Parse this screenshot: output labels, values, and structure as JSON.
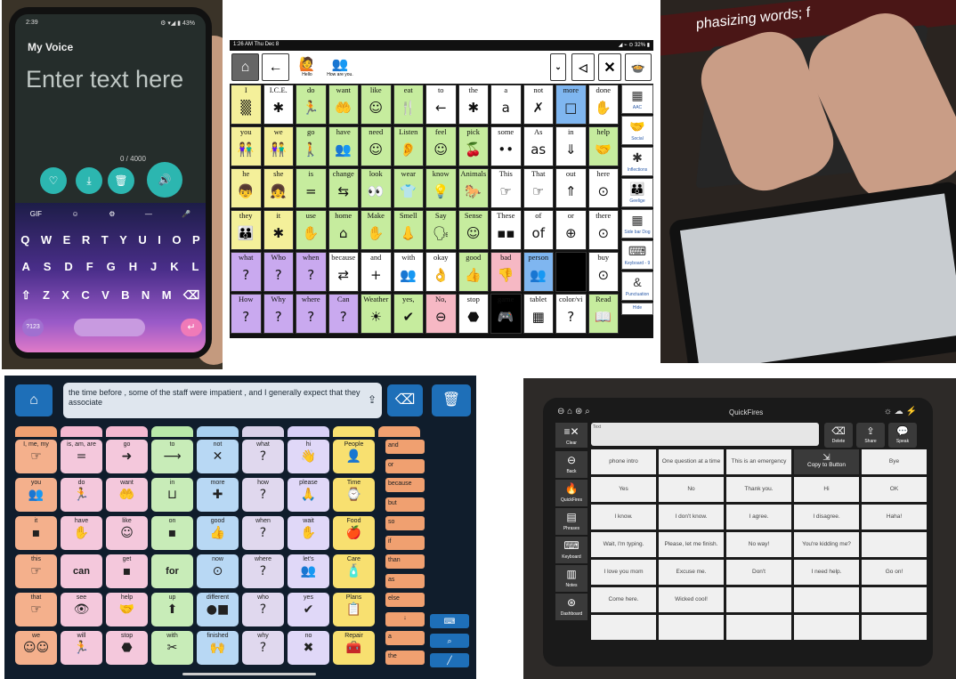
{
  "phone": {
    "time": "2:39",
    "status": "⚙ ▾◢ ▮ 43%",
    "app_title": "My Voice",
    "placeholder": "Enter text here",
    "counter": "0 / 4000",
    "rows": [
      [
        "Q",
        "W",
        "E",
        "R",
        "T",
        "Y",
        "U",
        "I",
        "O",
        "P"
      ],
      [
        "A",
        "S",
        "D",
        "F",
        "G",
        "H",
        "J",
        "K",
        "L"
      ],
      [
        "⇧",
        "Z",
        "X",
        "C",
        "V",
        "B",
        "N",
        "M",
        "⌫"
      ]
    ],
    "icons": [
      "heart-icon",
      "download-icon",
      "trash-icon",
      "speaker-icon"
    ],
    "num_key": "?123",
    "suggest": [
      "GIF",
      "☺",
      "⚙",
      "—",
      "🎤"
    ]
  },
  "grid": {
    "status": "1:26 AM  Thu Dec 8",
    "battery": "◢ ⌁ ⊙ 32% ▮",
    "phrases": [
      {
        "label": "Hello",
        "icon": "🙋"
      },
      {
        "label": "How are you.",
        "icon": "👥"
      }
    ],
    "cells": [
      [
        {
          "t": "I",
          "c": "#f4f09a",
          "i": "▒"
        },
        {
          "t": "I.C.E.",
          "c": "#fff",
          "i": "✱"
        },
        {
          "t": "do",
          "c": "#c6ec9e",
          "i": "🏃"
        },
        {
          "t": "want",
          "c": "#c6ec9e",
          "i": "🤲"
        },
        {
          "t": "like",
          "c": "#c6ec9e",
          "i": "☺"
        },
        {
          "t": "eat",
          "c": "#c6ec9e",
          "i": "🍴"
        },
        {
          "t": "to",
          "c": "#fff",
          "i": "←"
        },
        {
          "t": "the",
          "c": "#fff",
          "i": "✱"
        },
        {
          "t": "a",
          "c": "#fff",
          "i": "a"
        },
        {
          "t": "not",
          "c": "#fff",
          "i": "✗"
        },
        {
          "t": "more",
          "c": "#7fb6f0",
          "i": "□"
        },
        {
          "t": "done",
          "c": "#fff",
          "i": "✋"
        }
      ],
      [
        {
          "t": "you",
          "c": "#f4f09a",
          "i": "👫"
        },
        {
          "t": "we",
          "c": "#f4f09a",
          "i": "👫"
        },
        {
          "t": "go",
          "c": "#c6ec9e",
          "i": "🚶"
        },
        {
          "t": "have",
          "c": "#c6ec9e",
          "i": "👥"
        },
        {
          "t": "need",
          "c": "#c6ec9e",
          "i": "☺"
        },
        {
          "t": "Listen",
          "c": "#c6ec9e",
          "i": "👂"
        },
        {
          "t": "feel",
          "c": "#c6ec9e",
          "i": "☺"
        },
        {
          "t": "pick",
          "c": "#c6ec9e",
          "i": "🍒"
        },
        {
          "t": "some",
          "c": "#fff",
          "i": "••"
        },
        {
          "t": "As",
          "c": "#fff",
          "i": "as"
        },
        {
          "t": "in",
          "c": "#fff",
          "i": "⇓"
        },
        {
          "t": "help",
          "c": "#c6ec9e",
          "i": "🤝"
        }
      ],
      [
        {
          "t": "he",
          "c": "#f4f09a",
          "i": "👦"
        },
        {
          "t": "she",
          "c": "#f4f09a",
          "i": "👧"
        },
        {
          "t": "is",
          "c": "#c6ec9e",
          "i": "="
        },
        {
          "t": "change",
          "c": "#c6ec9e",
          "i": "⇆"
        },
        {
          "t": "look",
          "c": "#c6ec9e",
          "i": "👀"
        },
        {
          "t": "wear",
          "c": "#c6ec9e",
          "i": "👕"
        },
        {
          "t": "know",
          "c": "#c6ec9e",
          "i": "💡"
        },
        {
          "t": "Animals",
          "c": "#c6ec9e",
          "i": "🐎"
        },
        {
          "t": "This",
          "c": "#fff",
          "i": "☞"
        },
        {
          "t": "That",
          "c": "#fff",
          "i": "☞"
        },
        {
          "t": "out",
          "c": "#fff",
          "i": "⇑"
        },
        {
          "t": "here",
          "c": "#fff",
          "i": "⊙"
        }
      ],
      [
        {
          "t": "they",
          "c": "#f4f09a",
          "i": "👪"
        },
        {
          "t": "it",
          "c": "#f4f09a",
          "i": "✱"
        },
        {
          "t": "use",
          "c": "#c6ec9e",
          "i": "✋"
        },
        {
          "t": "home",
          "c": "#c6ec9e",
          "i": "⌂"
        },
        {
          "t": "Make",
          "c": "#c6ec9e",
          "i": "✋"
        },
        {
          "t": "Smell",
          "c": "#c6ec9e",
          "i": "👃"
        },
        {
          "t": "Say",
          "c": "#c6ec9e",
          "i": "🗣"
        },
        {
          "t": "Sense",
          "c": "#c6ec9e",
          "i": "☺"
        },
        {
          "t": "These",
          "c": "#fff",
          "i": "▪▪"
        },
        {
          "t": "of",
          "c": "#fff",
          "i": "of"
        },
        {
          "t": "or",
          "c": "#fff",
          "i": "⊕"
        },
        {
          "t": "there",
          "c": "#fff",
          "i": "⊙"
        }
      ],
      [
        {
          "t": "what",
          "c": "#c9a9ef",
          "i": "?"
        },
        {
          "t": "Who",
          "c": "#c9a9ef",
          "i": "?"
        },
        {
          "t": "when",
          "c": "#c9a9ef",
          "i": "?"
        },
        {
          "t": "because",
          "c": "#fff",
          "i": "⇄"
        },
        {
          "t": "and",
          "c": "#fff",
          "i": "+"
        },
        {
          "t": "with",
          "c": "#fff",
          "i": "👥"
        },
        {
          "t": "okay",
          "c": "#fff",
          "i": "👌"
        },
        {
          "t": "good",
          "c": "#c6ec9e",
          "i": "👍"
        },
        {
          "t": "bad",
          "c": "#f6b8c4",
          "i": "👎"
        },
        {
          "t": "person",
          "c": "#7fb6f0",
          "i": "👥"
        },
        {
          "t": "",
          "c": "#000",
          "i": ""
        },
        {
          "t": "buy",
          "c": "#fff",
          "i": "⊙"
        }
      ],
      [
        {
          "t": "How",
          "c": "#c9a9ef",
          "i": "?"
        },
        {
          "t": "Why",
          "c": "#c9a9ef",
          "i": "?"
        },
        {
          "t": "where",
          "c": "#c9a9ef",
          "i": "?"
        },
        {
          "t": "Can",
          "c": "#c9a9ef",
          "i": "?"
        },
        {
          "t": "Weather",
          "c": "#c6ec9e",
          "i": "☀"
        },
        {
          "t": "yes,",
          "c": "#c6ec9e",
          "i": "✔"
        },
        {
          "t": "No,",
          "c": "#f6b8c4",
          "i": "⊖"
        },
        {
          "t": "stop",
          "c": "#fff",
          "i": "⬣"
        },
        {
          "t": "game",
          "c": "#000",
          "i": "🎮"
        },
        {
          "t": "tablet",
          "c": "#fff",
          "i": "▦"
        },
        {
          "t": "color/vi",
          "c": "#fff",
          "i": "?"
        },
        {
          "t": "Read",
          "c": "#c6ec9e",
          "i": "📖"
        }
      ]
    ],
    "side": [
      {
        "t": "AAC",
        "i": "▦"
      },
      {
        "t": "Social",
        "i": "🤝"
      },
      {
        "t": "Inflections",
        "i": "✱"
      },
      {
        "t": "Geelige",
        "i": "👪"
      },
      {
        "t": "Side bar Dog",
        "i": "▦"
      },
      {
        "t": "Keyboard - 9",
        "i": "⌨"
      },
      {
        "t": "Punctuation",
        "i": "&"
      },
      {
        "t": "Hide",
        "i": ""
      }
    ]
  },
  "typing": {
    "screen_text": "phasizing words; f"
  },
  "board": {
    "message": "the time before , some of the staff were impatient , and I generally expect that they associate",
    "tab_colors": [
      "#f0a070",
      "#f4b8d0",
      "#f4b8d0",
      "#b8e8a8",
      "#a8d0f0",
      "#d8d0e8",
      "#d8d0f8",
      "#f8e070",
      "#f0a070"
    ],
    "rows": [
      [
        {
          "t": "I, me, my",
          "c": "#f4b08c",
          "i": "☞"
        },
        {
          "t": "is, am, are",
          "c": "#f4c8dc",
          "i": "="
        },
        {
          "t": "go",
          "c": "#f4c8dc",
          "i": "➜"
        },
        {
          "t": "to",
          "c": "#c8ecb8",
          "i": "⟶"
        },
        {
          "t": "not",
          "c": "#b8d8f4",
          "i": "✕"
        },
        {
          "t": "what",
          "c": "#e0d8ee",
          "i": "?"
        },
        {
          "t": "hi",
          "c": "#e0d8f8",
          "i": "👋"
        },
        {
          "t": "People",
          "c": "#f8e070",
          "i": "👤"
        }
      ],
      [
        {
          "t": "you",
          "c": "#f4b08c",
          "i": "👥"
        },
        {
          "t": "do",
          "c": "#f4c8dc",
          "i": "🏃"
        },
        {
          "t": "want",
          "c": "#f4c8dc",
          "i": "🤲"
        },
        {
          "t": "in",
          "c": "#c8ecb8",
          "i": "⊔"
        },
        {
          "t": "more",
          "c": "#b8d8f4",
          "i": "✚"
        },
        {
          "t": "how",
          "c": "#e0d8ee",
          "i": "?"
        },
        {
          "t": "please",
          "c": "#e0d8f8",
          "i": "🙏"
        },
        {
          "t": "Time",
          "c": "#f8e070",
          "i": "⌚"
        }
      ],
      [
        {
          "t": "it",
          "c": "#f4b08c",
          "i": "▪"
        },
        {
          "t": "have",
          "c": "#f4c8dc",
          "i": "✋"
        },
        {
          "t": "like",
          "c": "#f4c8dc",
          "i": "☺"
        },
        {
          "t": "on",
          "c": "#c8ecb8",
          "i": "▪"
        },
        {
          "t": "good",
          "c": "#b8d8f4",
          "i": "👍"
        },
        {
          "t": "when",
          "c": "#e0d8ee",
          "i": "?"
        },
        {
          "t": "wait",
          "c": "#e0d8f8",
          "i": "✋"
        },
        {
          "t": "Food",
          "c": "#f8e070",
          "i": "🍎"
        }
      ],
      [
        {
          "t": "this",
          "c": "#f4b08c",
          "i": "☞"
        },
        {
          "t": "can",
          "c": "#f4c8dc",
          "i": "",
          "b": 1
        },
        {
          "t": "get",
          "c": "#f4c8dc",
          "i": "▪"
        },
        {
          "t": "for",
          "c": "#c8ecb8",
          "i": "",
          "b": 1
        },
        {
          "t": "now",
          "c": "#b8d8f4",
          "i": "⊙"
        },
        {
          "t": "where",
          "c": "#e0d8ee",
          "i": "?"
        },
        {
          "t": "let's",
          "c": "#e0d8f8",
          "i": "👥"
        },
        {
          "t": "Care",
          "c": "#f8e070",
          "i": "🧴"
        }
      ],
      [
        {
          "t": "that",
          "c": "#f4b08c",
          "i": "☞"
        },
        {
          "t": "see",
          "c": "#f4c8dc",
          "i": "👁"
        },
        {
          "t": "help",
          "c": "#f4c8dc",
          "i": "🤝"
        },
        {
          "t": "up",
          "c": "#c8ecb8",
          "i": "⬆"
        },
        {
          "t": "different",
          "c": "#b8d8f4",
          "i": "●■"
        },
        {
          "t": "who",
          "c": "#e0d8ee",
          "i": "?"
        },
        {
          "t": "yes",
          "c": "#e0d8f8",
          "i": "✔"
        },
        {
          "t": "Plans",
          "c": "#f8e070",
          "i": "📋"
        }
      ],
      [
        {
          "t": "we",
          "c": "#f4b08c",
          "i": "☺☺"
        },
        {
          "t": "will",
          "c": "#f4c8dc",
          "i": "🏃"
        },
        {
          "t": "stop",
          "c": "#f4c8dc",
          "i": "⬣"
        },
        {
          "t": "with",
          "c": "#c8ecb8",
          "i": "✂"
        },
        {
          "t": "finished",
          "c": "#b8d8f4",
          "i": "🙌"
        },
        {
          "t": "why",
          "c": "#e0d8ee",
          "i": "?"
        },
        {
          "t": "no",
          "c": "#e0d8f8",
          "i": "✖"
        },
        {
          "t": "Repair",
          "c": "#f8e070",
          "i": "🧰"
        }
      ]
    ],
    "right": [
      "and",
      "or",
      "because",
      "but",
      "so",
      "if",
      "than",
      "as",
      "else",
      "↓",
      "a",
      "the"
    ]
  },
  "quick": {
    "title": "QuickFires",
    "text_hint": "Text",
    "copy": "Copy to Button",
    "top_buttons": [
      {
        "t": "Delete",
        "i": "⌫"
      },
      {
        "t": "Share",
        "i": "⇪"
      },
      {
        "t": "Speak",
        "i": "💬"
      }
    ],
    "clear": "Clear",
    "left": [
      {
        "t": "Back",
        "i": "⊖"
      },
      {
        "t": "QuickFires",
        "i": "🔥"
      },
      {
        "t": "Phrases",
        "i": "▤"
      },
      {
        "t": "Keyboard",
        "i": "⌨"
      },
      {
        "t": "Notes",
        "i": "▥"
      },
      {
        "t": "Dashboard",
        "i": "⊛"
      }
    ],
    "cells": [
      "phone intro",
      "One question at a time",
      "This is an emergency",
      "Copy to Button",
      "Bye",
      "Yes",
      "No",
      "Thank you.",
      "Hi",
      "OK",
      "I know.",
      "I don't know.",
      "I agree.",
      "I disagree.",
      "Haha!",
      "Wait, I'm typing.",
      "Please, let me finish.",
      "No way!",
      "You're kidding me?",
      "",
      "I love you mom",
      "Excuse me.",
      "Don't",
      "I need help.",
      "Go on!",
      "Come here.",
      "Wicked cool!",
      "",
      "",
      "",
      "",
      "",
      "",
      "",
      ""
    ]
  }
}
